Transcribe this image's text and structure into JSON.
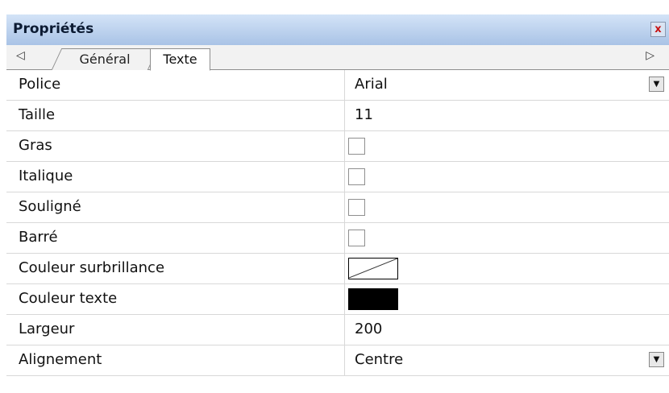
{
  "title": "Propriétés",
  "close_label": "x",
  "tabs": [
    {
      "label": "Général"
    },
    {
      "label": "Texte"
    }
  ],
  "nav": {
    "left": "◁",
    "right": "▷"
  },
  "dropdown_glyph": "▼",
  "properties": [
    {
      "name": "Police",
      "value": "Arial"
    },
    {
      "name": "Taille",
      "value": "11"
    },
    {
      "name": "Gras",
      "checked": false
    },
    {
      "name": "Italique",
      "checked": false
    },
    {
      "name": "Souligné",
      "checked": false
    },
    {
      "name": "Barré",
      "checked": false
    },
    {
      "name": "Couleur surbrillance",
      "color": "none"
    },
    {
      "name": "Couleur texte",
      "color": "#000000"
    },
    {
      "name": "Largeur",
      "value": "200"
    },
    {
      "name": "Alignement",
      "value": "Centre"
    }
  ]
}
